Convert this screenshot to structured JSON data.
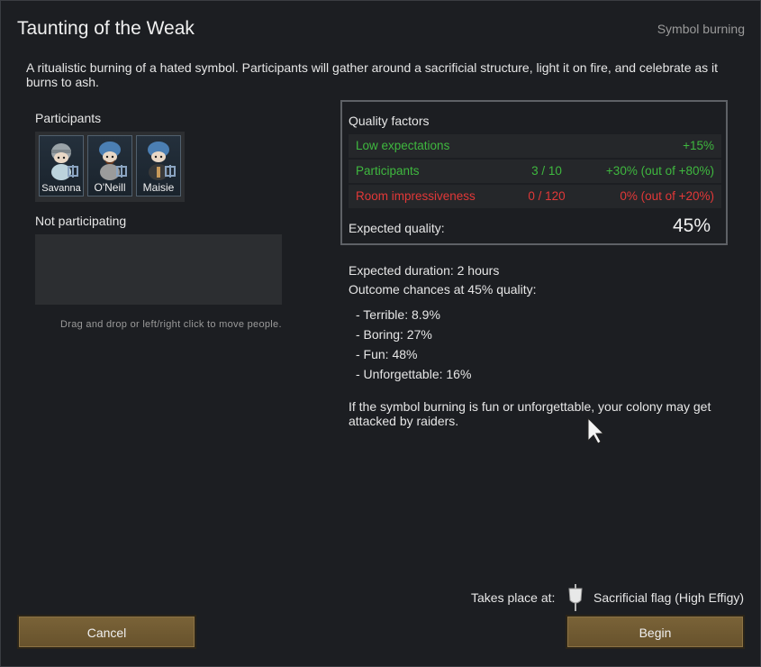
{
  "dialog": {
    "title": "Taunting of the Weak",
    "subtitle": "Symbol burning",
    "description": "A ritualistic burning of a hated symbol. Participants will gather around a sacrificial structure, light it on fire, and celebrate as it burns to ash."
  },
  "participants": {
    "label": "Participants",
    "pawns": [
      {
        "name": "Savanna",
        "icon": "pawn-portrait-helmet-icon"
      },
      {
        "name": "O'Neill",
        "icon": "pawn-portrait-cap-icon"
      },
      {
        "name": "Maisie",
        "icon": "pawn-portrait-cap-icon"
      }
    ]
  },
  "not_participating": {
    "label": "Not participating",
    "hint": "Drag and drop or left/right click to move people."
  },
  "quality": {
    "header": "Quality factors",
    "rows": [
      {
        "name": "Low expectations",
        "count": "",
        "value": "+15%",
        "color": "#3fb83f"
      },
      {
        "name": "Participants",
        "count": "3 / 10",
        "value": "+30% (out of +80%)",
        "color": "#3fb83f"
      },
      {
        "name": "Room impressiveness",
        "count": "0 / 120",
        "value": "0% (out of +20%)",
        "color": "#e23838"
      }
    ],
    "expected_label": "Expected quality:",
    "expected_value": "45%"
  },
  "outcome": {
    "duration": "Expected duration: 2 hours",
    "chances_label": "Outcome chances at 45% quality:",
    "chances": [
      "- Terrible: 8.9%",
      "- Boring: 27%",
      "- Fun: 48%",
      "- Unforgettable: 16%"
    ],
    "warning": "If the symbol burning is fun or unforgettable, your colony may get attacked by raiders."
  },
  "location": {
    "label": "Takes place at:",
    "target": "Sacrificial flag (High Effigy)",
    "icon": "sacrificial-flag-icon"
  },
  "buttons": {
    "cancel": "Cancel",
    "begin": "Begin"
  },
  "colors": {
    "positive": "#3fb83f",
    "negative": "#e23838",
    "button": "#735d34"
  }
}
